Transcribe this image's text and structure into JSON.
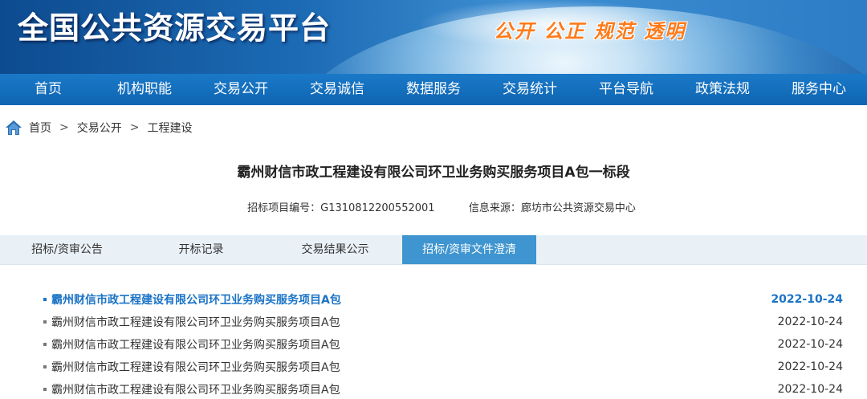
{
  "header": {
    "site_title": "全国公共资源交易平台",
    "slogan": "公开 公正 规范 透明"
  },
  "nav": {
    "items": [
      {
        "label": "首页"
      },
      {
        "label": "机构职能"
      },
      {
        "label": "交易公开"
      },
      {
        "label": "交易诚信"
      },
      {
        "label": "数据服务"
      },
      {
        "label": "交易统计"
      },
      {
        "label": "平台导航"
      },
      {
        "label": "政策法规"
      },
      {
        "label": "服务中心"
      }
    ]
  },
  "breadcrumb": {
    "icon": "home-icon",
    "items": [
      {
        "label": "首页"
      },
      {
        "label": "交易公开"
      },
      {
        "label": "工程建设"
      }
    ],
    "separator": ">"
  },
  "project": {
    "title": "霸州财信市政工程建设有限公司环卫业务购买服务项目A包一标段",
    "code_label": "招标项目编号：",
    "code_value": "G1310812200552001",
    "source_label": "信息来源：",
    "source_value": "廊坊市公共资源交易中心"
  },
  "tabs": [
    {
      "label": "招标/资审公告",
      "active": false
    },
    {
      "label": "开标记录",
      "active": false
    },
    {
      "label": "交易结果公示",
      "active": false
    },
    {
      "label": "招标/资审文件澄清",
      "active": true
    }
  ],
  "list": [
    {
      "title": "霸州财信市政工程建设有限公司环卫业务购买服务项目A包",
      "date": "2022-10-24",
      "highlight": true
    },
    {
      "title": "霸州财信市政工程建设有限公司环卫业务购买服务项目A包",
      "date": "2022-10-24",
      "highlight": false
    },
    {
      "title": "霸州财信市政工程建设有限公司环卫业务购买服务项目A包",
      "date": "2022-10-24",
      "highlight": false
    },
    {
      "title": "霸州财信市政工程建设有限公司环卫业务购买服务项目A包",
      "date": "2022-10-24",
      "highlight": false
    },
    {
      "title": "霸州财信市政工程建设有限公司环卫业务购买服务项目A包",
      "date": "2022-10-24",
      "highlight": false
    }
  ],
  "colors": {
    "nav_bg": "#1270bd",
    "tab_active": "#3f95cf",
    "link_highlight": "#1a73c6",
    "slogan": "#ff7a1a"
  }
}
